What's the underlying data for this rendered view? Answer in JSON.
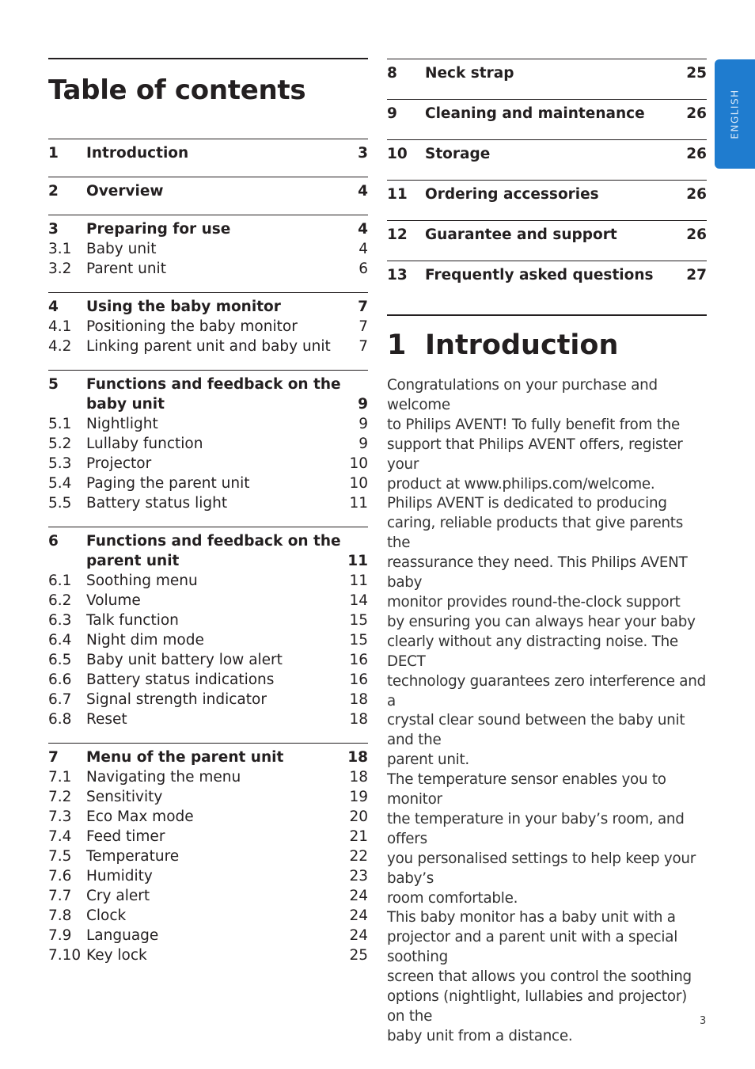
{
  "toc": {
    "title": "Table of contents",
    "left_sections": [
      {
        "num": "1",
        "label": "Introduction",
        "page": "3",
        "subs": []
      },
      {
        "num": "2",
        "label": "Overview",
        "page": "4",
        "subs": []
      },
      {
        "num": "3",
        "label": "Preparing for use",
        "page": "4",
        "subs": [
          {
            "num": "3.1",
            "label": "Baby unit",
            "page": "4"
          },
          {
            "num": "3.2",
            "label": "Parent unit",
            "page": "6"
          }
        ]
      },
      {
        "num": "4",
        "label": "Using the baby monitor",
        "page": "7",
        "subs": [
          {
            "num": "4.1",
            "label": "Positioning the baby monitor",
            "page": "7"
          },
          {
            "num": "4.2",
            "label": "Linking parent unit and baby unit",
            "page": "7"
          }
        ]
      },
      {
        "num": "5",
        "label_line1": "Functions and feedback on the",
        "label": "baby unit",
        "page": "9",
        "subs": [
          {
            "num": "5.1",
            "label": "Nightlight",
            "page": "9"
          },
          {
            "num": "5.2",
            "label": "Lullaby function",
            "page": "9"
          },
          {
            "num": "5.3",
            "label": "Projector",
            "page": "10"
          },
          {
            "num": "5.4",
            "label": "Paging the parent unit",
            "page": "10"
          },
          {
            "num": "5.5",
            "label": "Battery status light",
            "page": "11"
          }
        ]
      },
      {
        "num": "6",
        "label_line1": "Functions and feedback on the",
        "label": "parent unit",
        "page": "11",
        "subs": [
          {
            "num": "6.1",
            "label": "Soothing menu",
            "page": "11"
          },
          {
            "num": "6.2",
            "label": "Volume",
            "page": "14"
          },
          {
            "num": "6.3",
            "label": "Talk function",
            "page": "15"
          },
          {
            "num": "6.4",
            "label": "Night dim mode",
            "page": "15"
          },
          {
            "num": "6.5",
            "label": "Baby unit battery low alert",
            "page": "16"
          },
          {
            "num": "6.6",
            "label": "Battery status indications",
            "page": "16"
          },
          {
            "num": "6.7",
            "label": "Signal strength indicator",
            "page": "18"
          },
          {
            "num": "6.8",
            "label": "Reset",
            "page": "18"
          }
        ]
      },
      {
        "num": "7",
        "label": "Menu of the parent unit",
        "page": "18",
        "subs": [
          {
            "num": "7.1",
            "label": "Navigating the menu",
            "page": "18"
          },
          {
            "num": "7.2",
            "label": "Sensitivity",
            "page": "19"
          },
          {
            "num": "7.3",
            "label": "Eco Max mode",
            "page": "20"
          },
          {
            "num": "7.4",
            "label": "Feed timer",
            "page": "21"
          },
          {
            "num": "7.5",
            "label": "Temperature",
            "page": "22"
          },
          {
            "num": "7.6",
            "label": "Humidity",
            "page": "23"
          },
          {
            "num": "7.7",
            "label": "Cry alert",
            "page": "24"
          },
          {
            "num": "7.8",
            "label": "Clock",
            "page": "24"
          },
          {
            "num": "7.9",
            "label": "Language",
            "page": "24"
          },
          {
            "num": "7.10",
            "label": "Key lock",
            "page": "25"
          }
        ]
      }
    ],
    "right_sections": [
      {
        "num": "8",
        "label": "Neck strap",
        "page": "25"
      },
      {
        "num": "9",
        "label": "Cleaning and maintenance",
        "page": "26"
      },
      {
        "num": "10",
        "label": "Storage",
        "page": "26"
      },
      {
        "num": "11",
        "label": "Ordering accessories",
        "page": "26"
      },
      {
        "num": "12",
        "label": "Guarantee and support",
        "page": "26"
      },
      {
        "num": "13",
        "label": "Frequently asked questions",
        "page": "27"
      }
    ]
  },
  "introduction": {
    "number": "1",
    "title": "Introduction",
    "lines": [
      "Congratulations on your purchase and welcome",
      "to Philips AVENT! To fully benefit from the",
      "support that Philips AVENT offers, register your",
      "product at www.philips.com/welcome.",
      "Philips AVENT is dedicated to producing",
      "caring, reliable products that give parents the",
      "reassurance they need. This Philips AVENT baby",
      "monitor provides round-the-clock support",
      "by ensuring you can always hear your baby",
      "clearly without any distracting noise. The DECT",
      "technology guarantees zero interference and a",
      "crystal clear sound between the baby unit and the",
      "parent unit.",
      "The temperature sensor enables you to monitor",
      "the temperature in your baby’s room, and offers",
      "you personalised settings to help keep your baby’s",
      "room comfortable.",
      "This baby monitor has a baby unit with a",
      "projector and a parent unit with a special soothing",
      "screen that allows you control the soothing",
      "options (nightlight, lullabies and projector) on the",
      "baby unit from a distance."
    ]
  },
  "language_tab": {
    "label": "ENGLISH",
    "color": "#1f7ccf"
  },
  "page_number": "3"
}
